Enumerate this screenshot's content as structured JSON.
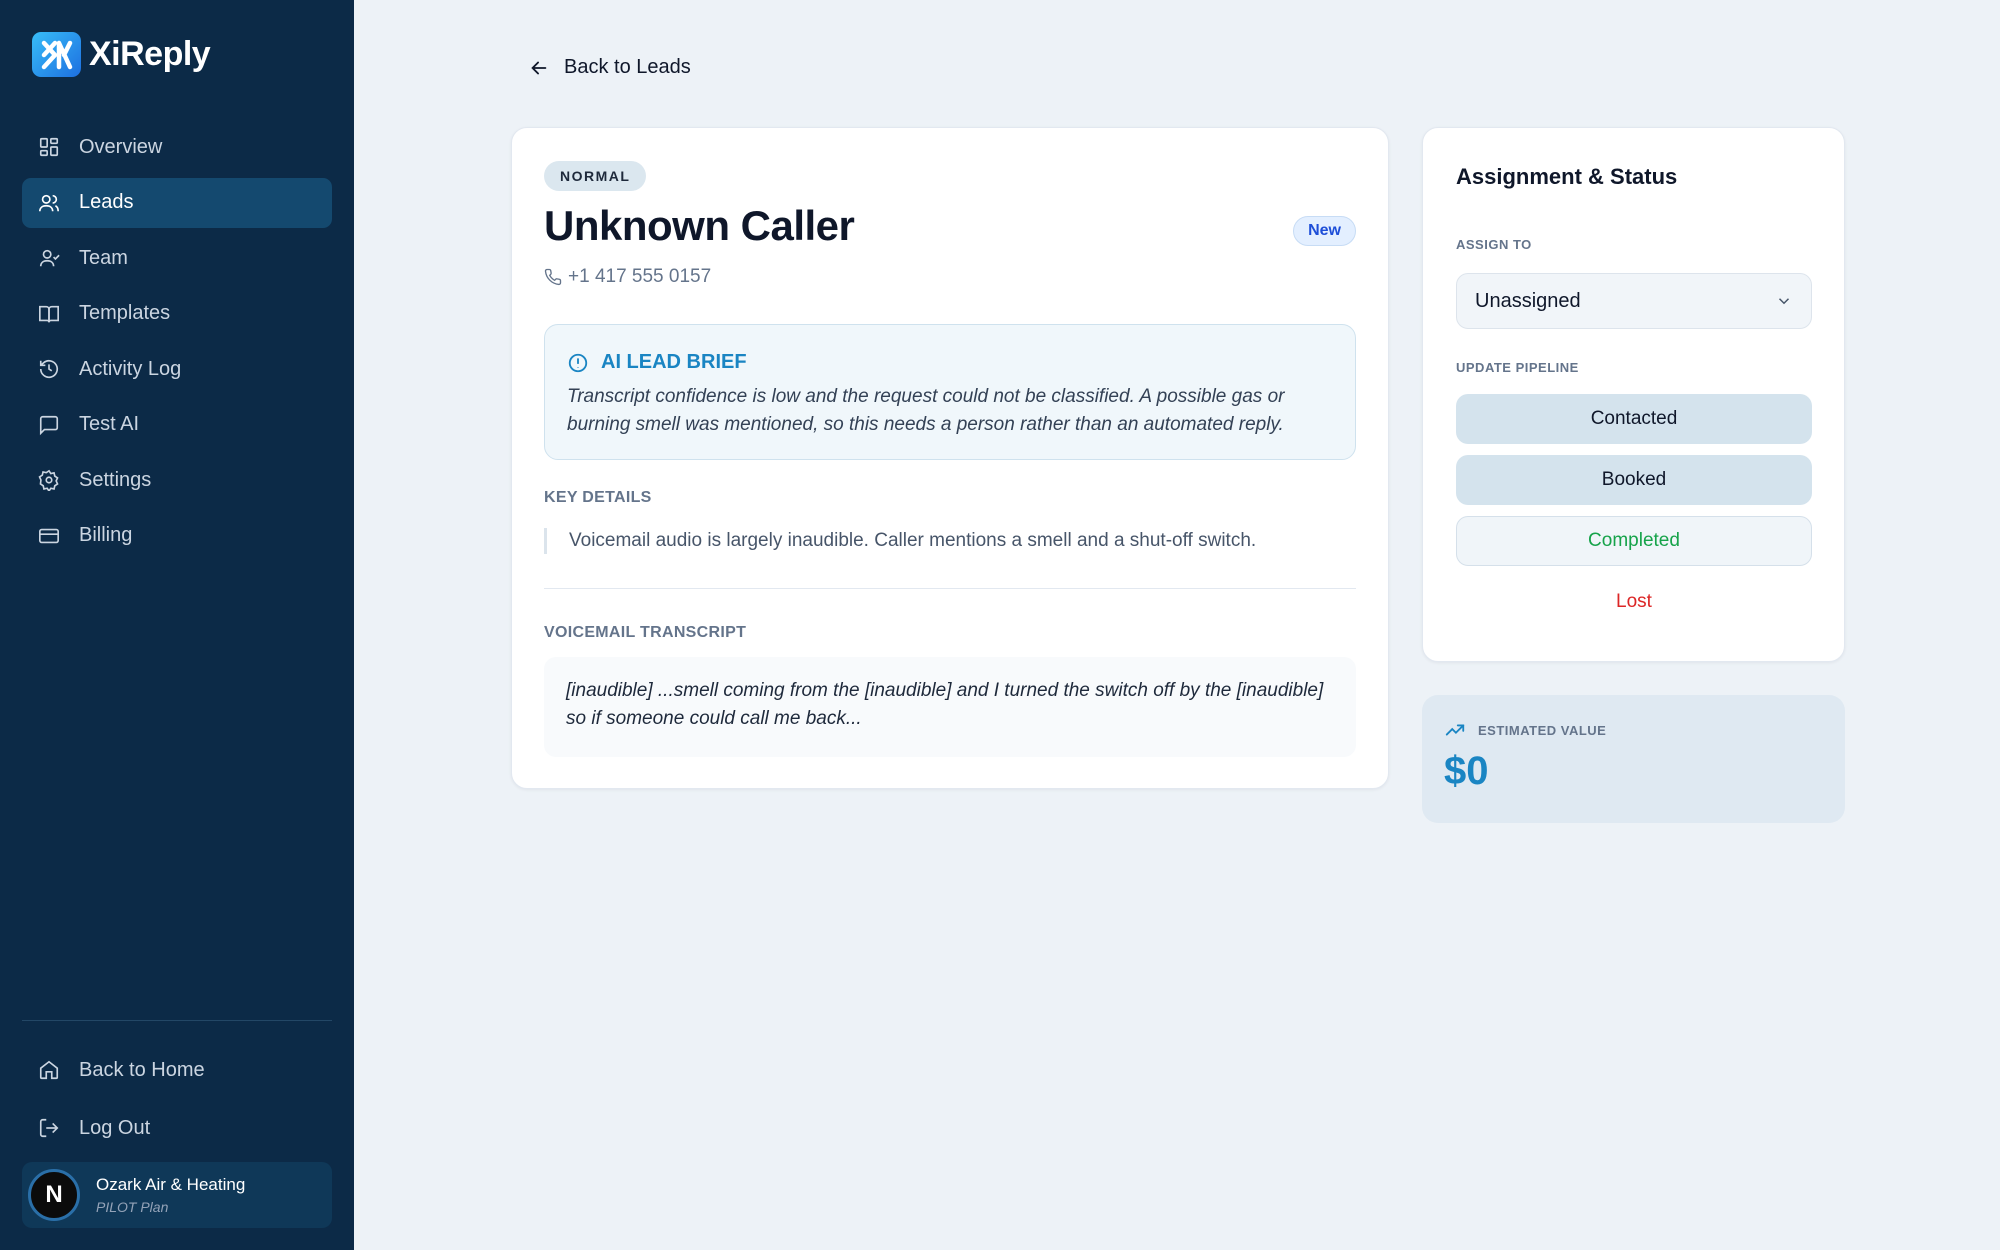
{
  "brand": {
    "name": "XiReply"
  },
  "sidebar": {
    "items": [
      {
        "label": "Overview",
        "icon": "grid-icon"
      },
      {
        "label": "Leads",
        "icon": "users-icon",
        "active": true
      },
      {
        "label": "Team",
        "icon": "user-group-icon"
      },
      {
        "label": "Templates",
        "icon": "book-icon"
      },
      {
        "label": "Activity Log",
        "icon": "history-icon"
      },
      {
        "label": "Test AI",
        "icon": "chat-icon"
      },
      {
        "label": "Settings",
        "icon": "gear-icon"
      },
      {
        "label": "Billing",
        "icon": "credit-card-icon"
      }
    ],
    "bottom": [
      {
        "label": "Back to Home",
        "icon": "home-icon"
      },
      {
        "label": "Log Out",
        "icon": "logout-icon"
      }
    ],
    "account": {
      "initial": "N",
      "name": "Ozark Air & Heating",
      "plan": "PILOT Plan"
    }
  },
  "main": {
    "back_label": "Back to Leads",
    "lead": {
      "priority": "NORMAL",
      "name": "Unknown Caller",
      "status": "New",
      "phone": "+1 417 555 0157",
      "brief_title": "AI LEAD BRIEF",
      "brief_text": "Transcript confidence is low and the request could not be classified. A possible gas or burning smell was mentioned, so this needs a person rather than an automated reply.",
      "key_details_label": "KEY DETAILS",
      "key_details": "Voicemail audio is largely inaudible. Caller mentions a smell and a shut-off switch.",
      "transcript_label": "VOICEMAIL TRANSCRIPT",
      "transcript": "[inaudible] ...smell coming from the [inaudible] and I turned the switch off by the [inaudible] so if someone could call me back..."
    }
  },
  "panel": {
    "title": "Assignment & Status",
    "assign_label": "ASSIGN TO",
    "assign_value": "Unassigned",
    "pipeline_label": "UPDATE PIPELINE",
    "pipeline": {
      "contacted": "Contacted",
      "booked": "Booked",
      "completed": "Completed",
      "lost": "Lost"
    },
    "value_label": "ESTIMATED VALUE",
    "value": "$0"
  },
  "colors": {
    "sidebar_bg": "#0c2a47",
    "accent": "#1a85c3",
    "active_nav": "#14496f",
    "success": "#16a34a",
    "danger": "#dc2626"
  }
}
